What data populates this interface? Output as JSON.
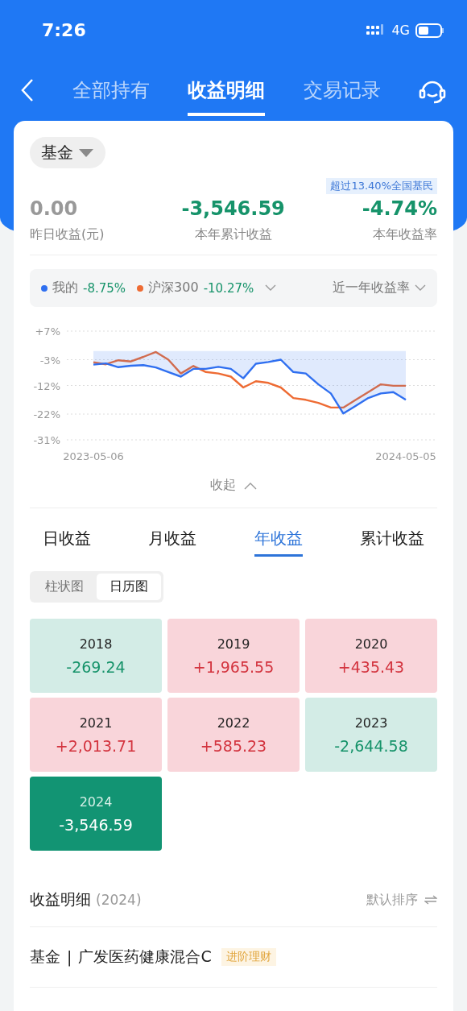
{
  "status_bar": {
    "time": "7:26",
    "network": "4G"
  },
  "nav": {
    "tabs": [
      {
        "label": "全部持有",
        "selected": false
      },
      {
        "label": "收益明细",
        "selected": true
      },
      {
        "label": "交易记录",
        "selected": false
      }
    ]
  },
  "summary": {
    "filter": "基金",
    "badge": "超过13.40%全国基民",
    "stats": [
      {
        "value": "0.00",
        "label": "昨日收益(元)",
        "kind": "neutral"
      },
      {
        "value": "-3,546.59",
        "label": "本年累计收益",
        "kind": "loss"
      },
      {
        "value": "-4.74%",
        "label": "本年收益率",
        "kind": "loss"
      }
    ]
  },
  "legend": {
    "items": [
      {
        "value": "-8.75%"
      },
      {
        "value": "-10.27%"
      }
    ],
    "period": "近一年收益率"
  },
  "chart_data": {
    "type": "line",
    "categories": [
      "2023-05-06",
      null,
      null,
      null,
      null,
      null,
      null,
      null,
      null,
      null,
      null,
      null,
      null,
      null,
      null,
      null,
      null,
      null,
      null,
      null,
      null,
      null,
      null,
      null,
      null,
      "2024-05-05"
    ],
    "series": [
      {
        "name": "我的",
        "color": "#2f6ff0",
        "type": "area",
        "values": [
          -4.7,
          -4.3,
          -5.6,
          -5.1,
          -4.9,
          -5.7,
          -7.3,
          -8.9,
          -6.2,
          -6.2,
          -5.5,
          -6.2,
          -9.5,
          -4.4,
          -3.8,
          -3.0,
          -7.3,
          -7.8,
          -11.6,
          -14.8,
          -21.8,
          -19.1,
          -16.4,
          -14.8,
          -14.3,
          -17.0
        ]
      },
      {
        "name": "沪深300",
        "color": "#ee6b33",
        "values": [
          -3.9,
          -4.6,
          -3.2,
          -3.6,
          -2.0,
          -0.3,
          -3.0,
          -7.8,
          -5.2,
          -7.3,
          -7.8,
          -8.9,
          -12.7,
          -10.5,
          -11.1,
          -12.7,
          -16.4,
          -17.0,
          -18.1,
          -19.7,
          -19.7,
          -17.0,
          -14.3,
          -11.6,
          -12.1,
          -12.1
        ]
      }
    ],
    "ylim": [
      -31,
      7
    ],
    "grid": true,
    "yticks": [
      {
        "value": 7,
        "label": "+7%"
      },
      {
        "value": -3,
        "label": "-3%"
      },
      {
        "value": -12,
        "label": "-12%"
      },
      {
        "value": -22,
        "label": "-22%"
      },
      {
        "value": -31,
        "label": "-31%"
      }
    ]
  },
  "collapse": "收起",
  "period_tabs": [
    {
      "label": "日收益",
      "selected": false
    },
    {
      "label": "月收益",
      "selected": false
    },
    {
      "label": "年收益",
      "selected": true
    },
    {
      "label": "累计收益",
      "selected": false
    }
  ],
  "view_toggle": [
    {
      "label": "柱状图",
      "selected": false
    },
    {
      "label": "日历图",
      "selected": true
    }
  ],
  "years": [
    {
      "year": "2018",
      "value": "-269.24",
      "kind": "loss",
      "selected": false
    },
    {
      "year": "2019",
      "value": "+1,965.55",
      "kind": "gain",
      "selected": false
    },
    {
      "year": "2020",
      "value": "+435.43",
      "kind": "gain",
      "selected": false
    },
    {
      "year": "2021",
      "value": "+2,013.71",
      "kind": "gain",
      "selected": false
    },
    {
      "year": "2022",
      "value": "+585.23",
      "kind": "gain",
      "selected": false
    },
    {
      "year": "2023",
      "value": "-2,644.58",
      "kind": "loss",
      "selected": false
    },
    {
      "year": "2024",
      "value": "-3,546.59",
      "kind": "loss",
      "selected": true
    }
  ],
  "detail": {
    "title": "收益明细",
    "year": "(2024)",
    "sort": "默认排序",
    "rows": [
      {
        "category": "基金",
        "separator": "|",
        "name": "广发医药健康混合C",
        "tag": "进阶理财"
      }
    ]
  }
}
